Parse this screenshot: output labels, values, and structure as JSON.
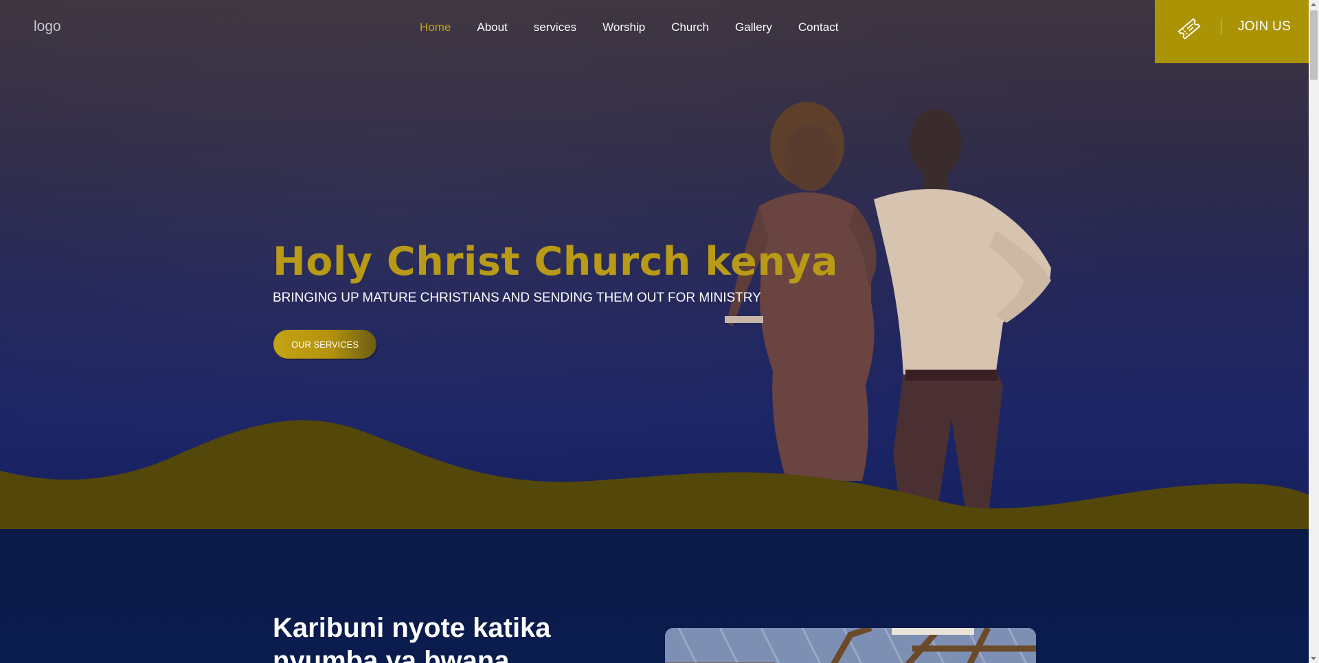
{
  "header": {
    "logo_alt": "logo",
    "nav": [
      {
        "label": "Home",
        "active": true
      },
      {
        "label": "About"
      },
      {
        "label": "services"
      },
      {
        "label": "Worship"
      },
      {
        "label": "Church"
      },
      {
        "label": "Gallery"
      },
      {
        "label": "Contact"
      }
    ],
    "join_label": "JOIN US",
    "join_icon": "ticket-icon"
  },
  "hero": {
    "title": "Holy Christ Church kenya",
    "subtitle": "BRINGING UP MATURE CHRISTIANS AND SENDING THEM OUT FOR MINISTRY",
    "button_label": "OUR SERVICES"
  },
  "welcome": {
    "heading": "Karibuni nyote katika nyumba ya bwana"
  },
  "colors": {
    "accent": "#ab9306",
    "title_gold": "#b89a16",
    "wave": "#54470a",
    "dark_navy": "#0b1a45"
  }
}
